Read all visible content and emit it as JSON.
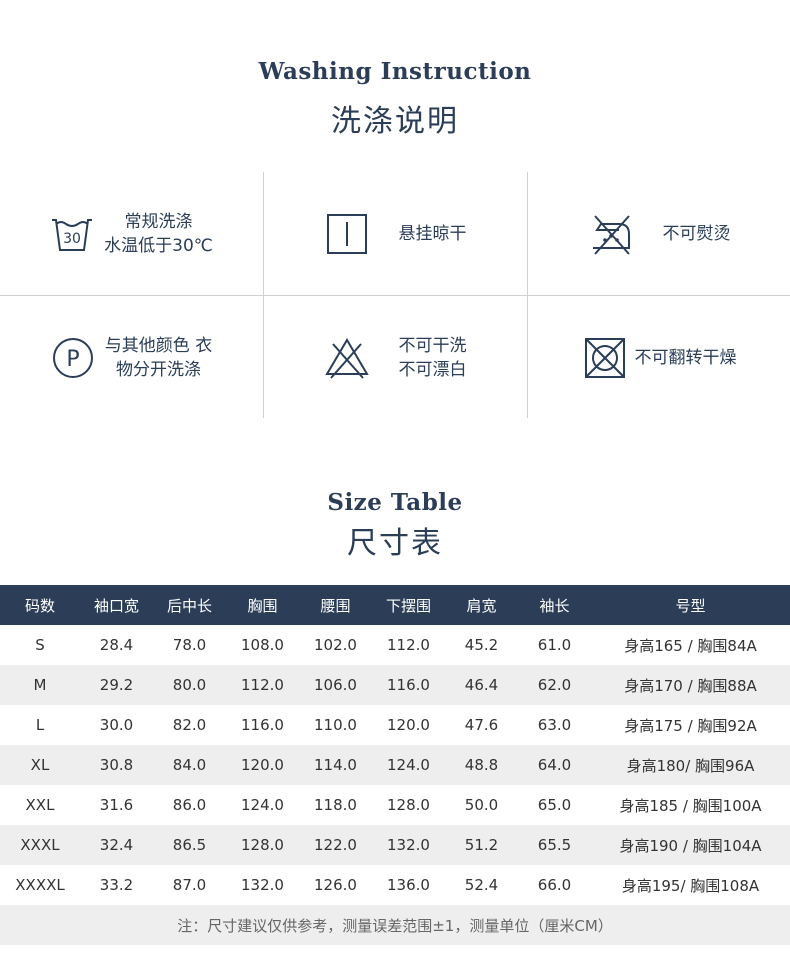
{
  "washing": {
    "title_en": "Washing Instruction",
    "title_cn": "洗涤说明",
    "items": [
      {
        "icon": "wash-30-icon",
        "lines": [
          "常规洗涤",
          "水温低于30℃"
        ],
        "icon_text": "30"
      },
      {
        "icon": "hang-dry-icon",
        "lines": [
          "悬挂晾干"
        ]
      },
      {
        "icon": "no-iron-icon",
        "lines": [
          "不可熨烫"
        ]
      },
      {
        "icon": "wash-separately-icon",
        "lines": [
          "与其他颜色 衣",
          "物分开洗涤"
        ],
        "icon_text": "P"
      },
      {
        "icon": "no-dry-clean-no-bleach-icon",
        "lines": [
          "不可干洗",
          "不可漂白"
        ]
      },
      {
        "icon": "no-tumble-dry-icon",
        "lines": [
          "不可翻转干燥"
        ]
      }
    ]
  },
  "size_table": {
    "title_en": "Size Table",
    "title_cn": "尺寸表",
    "headers": [
      "码数",
      "袖口宽",
      "后中长",
      "胸围",
      "腰围",
      "下摆围",
      "肩宽",
      "袖长",
      "号型"
    ],
    "rows": [
      [
        "S",
        "28.4",
        "78.0",
        "108.0",
        "102.0",
        "112.0",
        "45.2",
        "61.0",
        "身高165 / 胸围84A"
      ],
      [
        "M",
        "29.2",
        "80.0",
        "112.0",
        "106.0",
        "116.0",
        "46.4",
        "62.0",
        "身高170 / 胸围88A"
      ],
      [
        "L",
        "30.0",
        "82.0",
        "116.0",
        "110.0",
        "120.0",
        "47.6",
        "63.0",
        "身高175 / 胸围92A"
      ],
      [
        "XL",
        "30.8",
        "84.0",
        "120.0",
        "114.0",
        "124.0",
        "48.8",
        "64.0",
        "身高180/ 胸围96A"
      ],
      [
        "XXL",
        "31.6",
        "86.0",
        "124.0",
        "118.0",
        "128.0",
        "50.0",
        "65.0",
        "身高185 / 胸围100A"
      ],
      [
        "XXXL",
        "32.4",
        "86.5",
        "128.0",
        "122.0",
        "132.0",
        "51.2",
        "65.5",
        "身高190 / 胸围104A"
      ],
      [
        "XXXXL",
        "33.2",
        "87.0",
        "132.0",
        "126.0",
        "136.0",
        "52.4",
        "66.0",
        "身高195/ 胸围108A"
      ]
    ],
    "note": "注：尺寸建议仅供参考，测量误差范围±1，测量单位（厘米CM）"
  },
  "colors": {
    "navy": "#2b3d57",
    "row_alt": "#eeeeee",
    "divider": "#d0d0d0"
  }
}
